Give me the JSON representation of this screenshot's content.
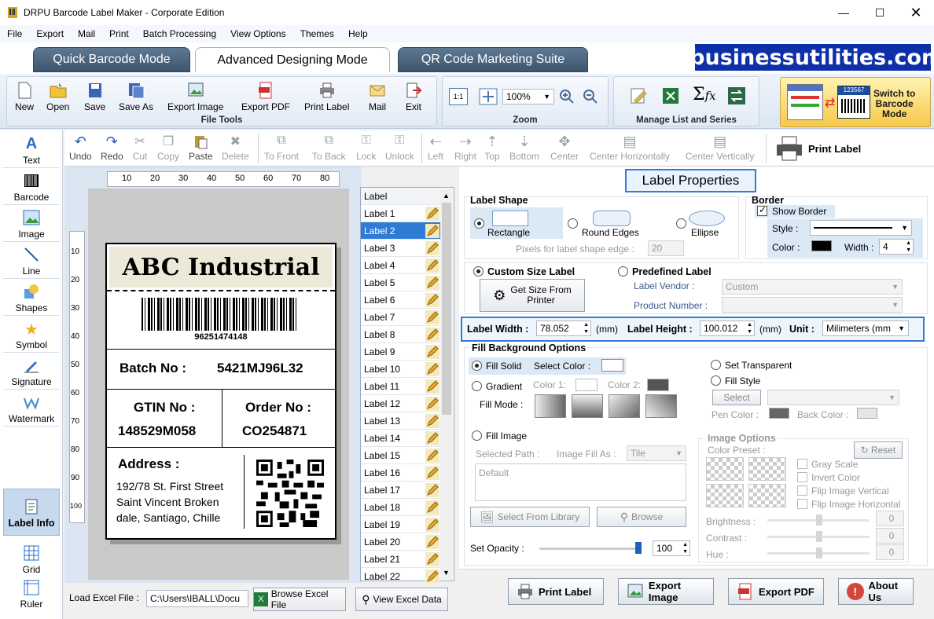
{
  "window": {
    "title": "DRPU Barcode Label Maker - Corporate Edition"
  },
  "menu": [
    "File",
    "Export",
    "Mail",
    "Print",
    "Batch Processing",
    "View Options",
    "Themes",
    "Help"
  ],
  "mode_tabs": [
    "Quick Barcode Mode",
    "Advanced Designing Mode",
    "QR Code Marketing Suite"
  ],
  "brand": "ibusinessutilities.com",
  "ribbon": {
    "file_tools": {
      "label": "File Tools",
      "buttons": [
        "New",
        "Open",
        "Save",
        "Save As",
        "Export Image",
        "Export PDF",
        "Print Label",
        "Mail",
        "Exit"
      ]
    },
    "zoom": {
      "label": "Zoom",
      "value": "100%",
      "fit_label": "1:1"
    },
    "manage": {
      "label": "Manage List and Series"
    },
    "switch": {
      "line1": "Switch to",
      "line2": "Barcode",
      "line3": "Mode",
      "preview_number": "123567"
    }
  },
  "left_tools": [
    "Text",
    "Barcode",
    "Image",
    "Line",
    "Shapes",
    "Symbol",
    "Signature",
    "Watermark"
  ],
  "left_bottom": {
    "label_info": "Label Info",
    "grid": "Grid",
    "ruler": "Ruler"
  },
  "edit_toolbar": {
    "buttons": [
      "Undo",
      "Redo",
      "Cut",
      "Copy",
      "Paste",
      "Delete",
      "To Front",
      "To Back",
      "Lock",
      "Unlock",
      "Left",
      "Right",
      "Top",
      "Bottom",
      "Center",
      "Center Horizontally",
      "Center Vertically"
    ],
    "print_label": "Print Label"
  },
  "ruler": {
    "top": [
      "10",
      "20",
      "30",
      "40",
      "50",
      "60",
      "70",
      "80"
    ],
    "left": [
      "10",
      "20",
      "30",
      "40",
      "50",
      "60",
      "70",
      "80",
      "90",
      "100"
    ]
  },
  "label_design": {
    "header": "ABC Industrial",
    "barcode_number": "96251474148",
    "batch_label": "Batch No :",
    "batch_value": "5421MJ96L32",
    "gtin_label": "GTIN No :",
    "gtin_value": "148529M058",
    "order_label": "Order No :",
    "order_value": "CO254871",
    "address_label": "Address :",
    "address_lines": [
      "192/78 St. First Street",
      "Saint Vincent Broken",
      "dale, Santiago, Chille"
    ]
  },
  "label_list": {
    "header": "Label",
    "items": [
      "Label 1",
      "Label 2",
      "Label 3",
      "Label 4",
      "Label 5",
      "Label 6",
      "Label 7",
      "Label 8",
      "Label 9",
      "Label 10",
      "Label 11",
      "Label 12",
      "Label 13",
      "Label 14",
      "Label 15",
      "Label 16",
      "Label 17",
      "Label 18",
      "Label 19",
      "Label 20",
      "Label 21",
      "Label 22"
    ],
    "selected": "Label 2"
  },
  "excel": {
    "load_label": "Load Excel File :",
    "path": "C:\\Users\\IBALL\\Docu",
    "browse": "Browse Excel File",
    "view": "View Excel Data"
  },
  "props": {
    "title": "Label Properties",
    "label_shape": {
      "title": "Label Shape",
      "rectangle": "Rectangle",
      "round": "Round Edges",
      "ellipse": "Ellipse",
      "pixels_label": "Pixels for label shape edge :",
      "pixels_value": "20"
    },
    "border": {
      "title": "Border",
      "show": "Show Border",
      "style_label": "Style :",
      "color_label": "Color :",
      "width_label": "Width :",
      "width_value": "4"
    },
    "size": {
      "custom": "Custom Size Label",
      "predefined": "Predefined Label",
      "get_size_line1": "Get Size From",
      "get_size_line2": "Printer",
      "vendor_label": "Label Vendor :",
      "vendor_value": "Custom",
      "product_label": "Product Number :"
    },
    "dims": {
      "width_label": "Label Width :",
      "width_value": "78.052",
      "unit_mm": "(mm)",
      "height_label": "Label Height :",
      "height_value": "100.012",
      "unit_label": "Unit :",
      "unit_value": "Milimeters (mm"
    },
    "fill": {
      "title": "Fill Background Options",
      "solid": "Fill Solid",
      "select_color": "Select Color :",
      "gradient": "Gradient",
      "color1": "Color 1:",
      "color2": "Color 2:",
      "fill_mode": "Fill Mode :",
      "transparent": "Set Transparent",
      "fill_style": "Fill Style",
      "select": "Select",
      "pen_color": "Pen Color :",
      "back_color": "Back Color :",
      "fill_image": "Fill Image",
      "selected_path": "Selected Path :",
      "image_fill_as": "Image Fill As :",
      "tile": "Tile",
      "default_path": "Default",
      "select_library": "Select From Library",
      "browse": "Browse",
      "opacity_label": "Set Opacity :",
      "opacity_value": "100"
    },
    "image_options": {
      "title": "Image Options",
      "color_preset": "Color Preset :",
      "reset": "Reset",
      "gray": "Gray Scale",
      "invert": "Invert Color",
      "flip_v": "Flip Image Vertical",
      "flip_h": "Flip Image Horizontal",
      "brightness": "Brightness :",
      "contrast": "Contrast :",
      "hue": "Hue :",
      "zero": "0"
    },
    "actions": [
      "Print Label",
      "Export Image",
      "Export PDF",
      "About Us"
    ]
  },
  "colors": {
    "accent": "#2f7bd6",
    "brand_bg": "#0d2fa8",
    "label_header_bg": "#ece9d8"
  }
}
